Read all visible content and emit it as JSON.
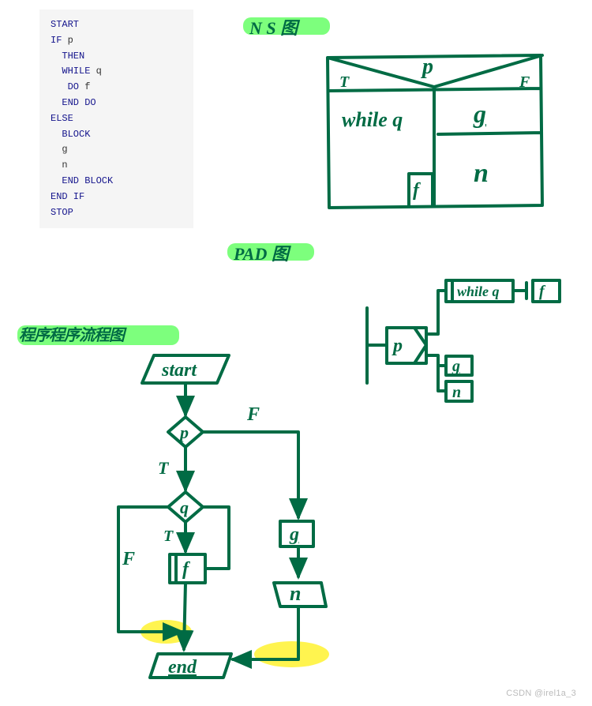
{
  "code": {
    "line1": "START",
    "line2_kw": "IF ",
    "line2_id": "p",
    "line3": "  THEN",
    "line4_kw": "  WHILE ",
    "line4_id": "q",
    "line5_kw": "   DO ",
    "line5_id": "f",
    "line6": "  END DO",
    "line7": "ELSE",
    "line8": "  BLOCK",
    "line9": "  g",
    "line10": "  n",
    "line11": "  END BLOCK",
    "line12": "END IF",
    "line13": "STOP"
  },
  "labels": {
    "ns_title": "N S 图",
    "pad_title": "PAD 图",
    "flow_title": "程序程序流程图"
  },
  "ns": {
    "p": "p",
    "t": "T",
    "f": "F",
    "while_q": "while q",
    "box_f": "f",
    "g": "g",
    "n": "n"
  },
  "pad": {
    "p": "p",
    "while_q": "while q",
    "f": "f",
    "g": "g",
    "n": "n"
  },
  "flow": {
    "start": "start",
    "p": "p",
    "q": "q",
    "f_label": "f",
    "g": "g",
    "n": "n",
    "end": "end",
    "t1": "T",
    "t2": "T",
    "f1": "F",
    "f2": "F"
  },
  "watermark": "CSDN @irel1a_3"
}
